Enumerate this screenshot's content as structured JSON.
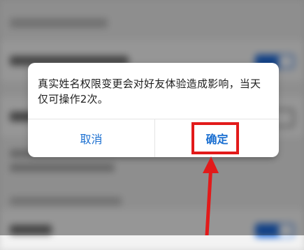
{
  "dialog": {
    "message": "真实姓名权限变更会对好友体验造成影响，当天仅可操作2次。",
    "cancel_label": "取消",
    "confirm_label": "确定"
  },
  "colors": {
    "button_text": "#1a6fd1",
    "highlight": "#e21a1a",
    "toggle_on": "#1e6ad9"
  },
  "icons": {
    "annotation_arrow": "up-arrow-icon"
  }
}
